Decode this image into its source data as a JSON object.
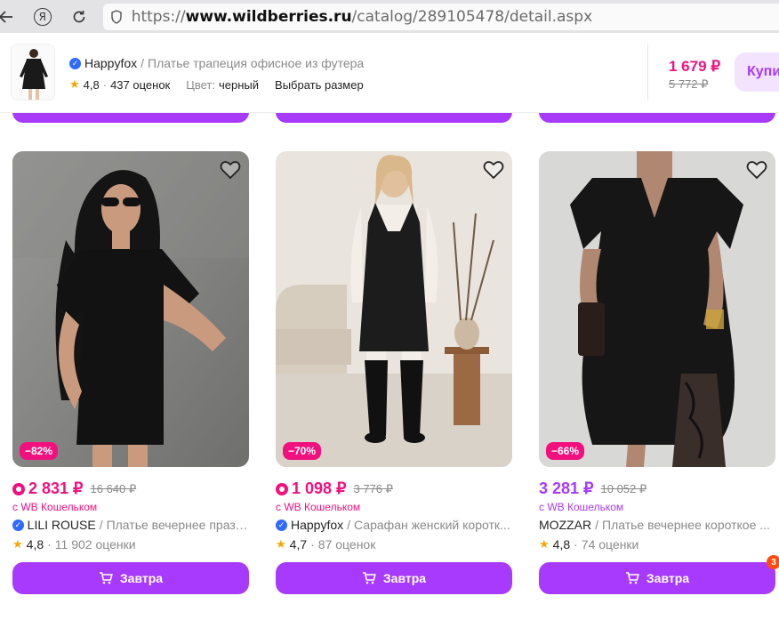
{
  "browser": {
    "url_prefix": "https://",
    "url_domain": "www.wildberries.ru",
    "url_path": "/catalog/289105478/detail.aspx",
    "ya_label": "Я"
  },
  "sticky": {
    "brand": "Happyfox",
    "separator": "/",
    "title": "Платье трапеция офисное из футера",
    "rating": "4,8",
    "dot": "·",
    "reviews": "437 оценок",
    "color_label": "Цвет:",
    "color_value": "черный",
    "size_button": "Выбрать размер",
    "price_now": "1 679 ₽",
    "price_old": "5 772 ₽",
    "buy_label": "Купи"
  },
  "colors": {
    "accent": "#a73afd",
    "pink": "#f1117e",
    "star": "#f7a600"
  },
  "cards": [
    {
      "discount": "−82%",
      "price_now": "2 831 ₽",
      "price_old": "16 640 ₽",
      "wallet": "с WB Кошельком",
      "brand": "LILI ROUSE",
      "verified": true,
      "title": "Платье вечернее празд...",
      "rating": "4,8",
      "reviews": "11 902 оценки",
      "cart_label": "Завтра"
    },
    {
      "discount": "−70%",
      "price_now": "1 098 ₽",
      "price_old": "3 776 ₽",
      "wallet": "с WB Кошельком",
      "brand": "Happyfox",
      "verified": true,
      "title": "Сарафан женский коротк...",
      "rating": "4,7",
      "reviews": "87 оценок",
      "cart_label": "Завтра"
    },
    {
      "discount": "−66%",
      "price_now": "3 281 ₽",
      "price_old": "10 052 ₽",
      "wallet": "с WB Кошельком",
      "brand": "MOZZAR",
      "verified": false,
      "title": "Платье вечернее короткое ...",
      "rating": "4,8",
      "reviews": "74 оценки",
      "cart_label": "Завтра",
      "cart_badge": "3"
    }
  ],
  "common": {
    "separator": "/",
    "dot": "·",
    "star": "★"
  }
}
